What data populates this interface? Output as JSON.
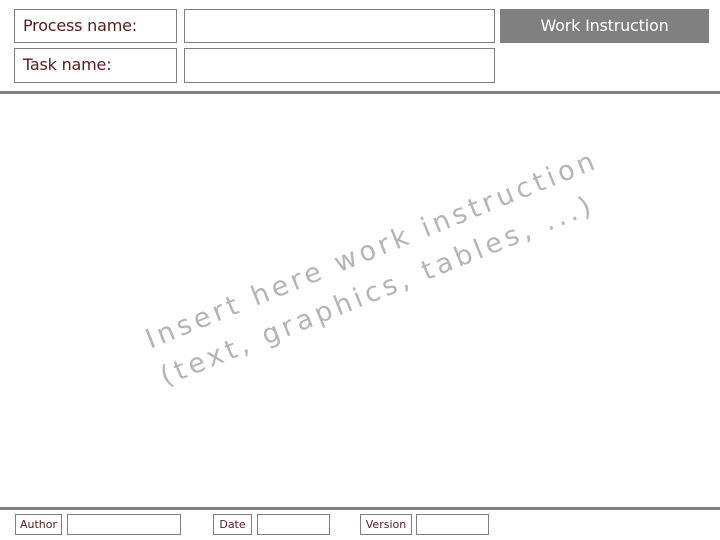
{
  "header": {
    "process_label": "Process name:",
    "process_value": "",
    "task_label": "Task name:",
    "task_value": "",
    "doc_type": "Work Instruction"
  },
  "content": {
    "placeholder_line1": "Insert here work instruction",
    "placeholder_line2": "(text, graphics, tables, ...)"
  },
  "footer": {
    "author_label": "Author",
    "author_value": "",
    "date_label": "Date",
    "date_value": "",
    "version_label": "Version",
    "version_value": ""
  },
  "colors": {
    "label_text": "#5a1a1a",
    "border": "#7f7f7f",
    "header_button_bg": "#808080",
    "watermark": "#b4b4b4"
  }
}
